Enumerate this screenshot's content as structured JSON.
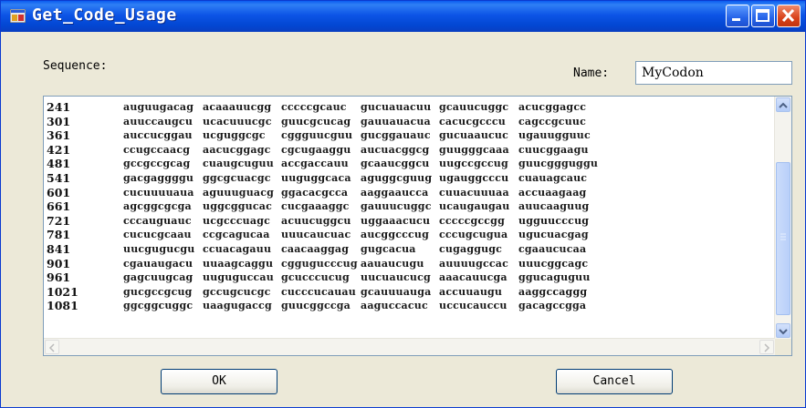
{
  "window": {
    "title": "Get_Code_Usage"
  },
  "form": {
    "sequence_label": "Sequence:",
    "name_label": "Name:",
    "name_value": "MyCodon"
  },
  "rows": [
    {
      "num": "241",
      "segs": [
        "auguugacag",
        "acaaauucgg",
        "cccccgcauc",
        "gucuauacuu",
        "gcauucuggc",
        "acucggagcc"
      ]
    },
    {
      "num": "301",
      "segs": [
        "auuccaugcu",
        "ucacuuucgc",
        "guucgcucag",
        "gauuauacua",
        "cacucgcccu",
        "cagccgcuuc"
      ]
    },
    {
      "num": "361",
      "segs": [
        "auccucggau",
        "ucguggcgc",
        "cggguucguu",
        "gucggauauc",
        "gucuaaucuc",
        "ugauugguuc"
      ]
    },
    {
      "num": "421",
      "segs": [
        "ccugccaacg",
        "aacucggagc",
        "cgcugaaggu",
        "aucuacggcg",
        "guugggcaaa",
        "cuucggaagu"
      ]
    },
    {
      "num": "481",
      "segs": [
        "gccgccgcag",
        "cuaugcuguu",
        "accgaccauu",
        "gcaaucggcu",
        "uugccgccug",
        "guucggguggu"
      ]
    },
    {
      "num": "541",
      "segs": [
        "gacgaggggu",
        "ggcgcuacgc",
        "uuguggcaca",
        "aguggcguug",
        "ugauggcccu",
        "cuauagcauc"
      ]
    },
    {
      "num": "601",
      "segs": [
        "cucuuuuaua",
        "aguuuguacg",
        "ggacacgcca",
        "aaggaaucca",
        "cuuacuuuaa",
        "accuaagaag"
      ]
    },
    {
      "num": "661",
      "segs": [
        "agcggcgcga",
        "uggcggucac",
        "cucgaaaggc",
        "gauuucuggc",
        "ucaugaugau",
        "auucaaguug"
      ]
    },
    {
      "num": "721",
      "segs": [
        "cccauguauc",
        "ucgcccuagc",
        "acuucuggcu",
        "uggaaacucu",
        "cccccgccgg",
        "ugguucccug"
      ]
    },
    {
      "num": "781",
      "segs": [
        "cucucgcaau",
        "ccgcagucaa",
        "uuucaucuac",
        "aucggcccug",
        "cccugcugua",
        "ugucuacgag"
      ]
    },
    {
      "num": "841",
      "segs": [
        "uucgugucgu",
        "ccuacagauu",
        "caacaaggag",
        "gugcacua",
        "cugaggugc",
        "cgaaucucaa"
      ]
    },
    {
      "num": "901",
      "segs": [
        "cgauaugacu",
        "uuaagcaggu",
        "cggugucccug",
        "aauaucugu",
        "auuuugccac",
        "uuucggcagc"
      ]
    },
    {
      "num": "961",
      "segs": [
        "gagcuugcag",
        "uuguguccau",
        "gcucccucug",
        "uucuaucucg",
        "aaacauucga",
        "ggucaguguu"
      ]
    },
    {
      "num": "1021",
      "segs": [
        "gucgccgcug",
        "gccugcucgc",
        "cucccucauau",
        "gcauuuauga",
        "accuuaugu",
        "aaggccaggg"
      ]
    },
    {
      "num": "1081",
      "segs": [
        "ggcggcuggc",
        "uaagugaccg",
        "guucggccga",
        "aaguccacuc",
        "uccucauccu",
        "gacagccgga"
      ]
    }
  ],
  "buttons": {
    "ok": "OK",
    "cancel": "Cancel"
  },
  "icons": {
    "app": "app-window-icon",
    "minimize": "minimize-icon",
    "maximize": "maximize-icon",
    "close": "close-icon"
  }
}
